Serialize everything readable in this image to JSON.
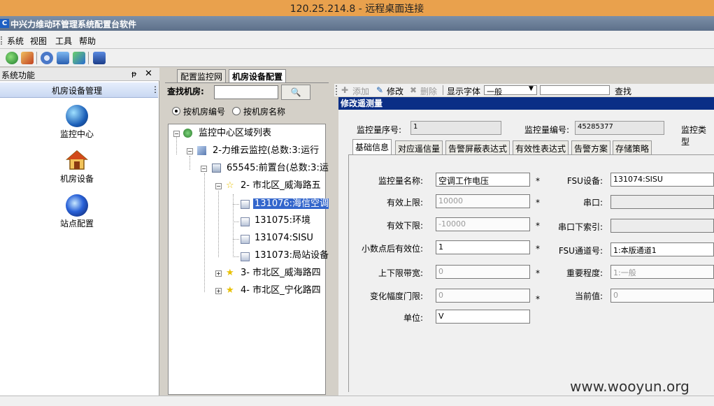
{
  "rdp": {
    "title": "120.25.214.8 - 远程桌面连接"
  },
  "app": {
    "title": "中兴力维动环管理系统配置台软件"
  },
  "menu": [
    "系统",
    "视图",
    "工具",
    "帮助"
  ],
  "sidebar": {
    "title": "系统功能",
    "pin": "ᵽ",
    "close": "✕",
    "group": "机房设备管理",
    "group_dots": "⋮",
    "items": [
      {
        "label": "监控中心",
        "icon": "globe-icon"
      },
      {
        "label": "机房设备",
        "icon": "house-icon"
      },
      {
        "label": "站点配置",
        "icon": "network-orb-icon"
      }
    ]
  },
  "tabs": [
    "配置监控网",
    "机房设备配置"
  ],
  "search": {
    "label": "查找机房:",
    "button": "🔍",
    "value": ""
  },
  "radios": [
    {
      "label": "按机房编号",
      "checked": true
    },
    {
      "label": "按机房名称",
      "checked": false
    }
  ],
  "tree": {
    "root": "监控中心区域列表",
    "n1": "2-力维云监控(总数:3:运行",
    "n2": "65545:前置台(总数:3:运",
    "n3": "2- 市北区_威海路五",
    "n3a": "131076:海信空调",
    "n3b": "131075:环境",
    "n3c": "131074:SISU",
    "n3d": "131073:局站设备",
    "n4": "3- 市北区_威海路四",
    "n5": "4- 市北区_宁化路四"
  },
  "right_toolbar": {
    "add": "添加",
    "edit": "修改",
    "delete": "删除",
    "font": "显示字体",
    "font_value": "一般",
    "search": "查找"
  },
  "dialog": {
    "title": "修改遥测量",
    "seq_label": "监控量序号:",
    "seq_value": "1",
    "id_label": "监控量编号:",
    "id_value": "45285377",
    "type_label": "监控类型"
  },
  "form_tabs": [
    "基础信息",
    "对应遥信量",
    "告警屏蔽表达式",
    "有效性表达式",
    "告警方案",
    "存储策略"
  ],
  "form": {
    "name_label": "监控量名称:",
    "name_value": "空调工作电压",
    "upper_label": "有效上限:",
    "upper_value": "10000",
    "lower_label": "有效下限:",
    "lower_value": "-10000",
    "decimal_label": "小数点后有效位:",
    "decimal_value": "1",
    "band_label": "上下限带宽:",
    "band_value": "0",
    "change_label": "变化幅度门限:",
    "change_value": "0",
    "unit_label": "单位:",
    "unit_value": "V",
    "fsu_label": "FSU设备:",
    "fsu_value": "131074:SISU",
    "serial_label": "串口:",
    "serial_value": "",
    "serial_idx_label": "串口下索引:",
    "serial_idx_value": "",
    "channel_label": "FSU通道号:",
    "channel_value": "1:本版通道1",
    "importance_label": "重要程度:",
    "importance_value": "1:一般",
    "current_label": "当前值:",
    "current_value": "0",
    "star": "*"
  },
  "watermark": "www.wooyun.org"
}
